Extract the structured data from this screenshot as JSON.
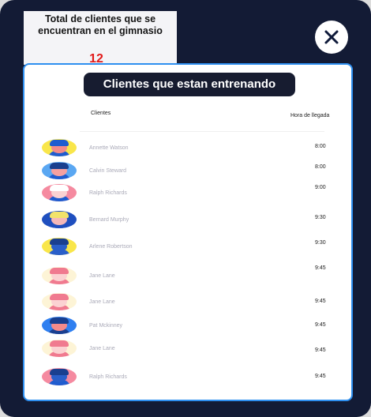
{
  "summary": {
    "title_line1": "Total de clientes que se",
    "title_line2": "encuentran en  el gimnasio",
    "count": "12"
  },
  "panel": {
    "title": "Clientes que estan entrenando",
    "col_clients": "Clientes",
    "col_arrival": "Hora de llegada"
  },
  "close_icon": "close-icon",
  "clients": [
    {
      "name": "Annette Watson",
      "time": "8:00",
      "bg": "#f9e64a",
      "skin": "#f28b8b",
      "hair": "#1f5ccf",
      "body": "#1f5ccf"
    },
    {
      "name": "Calvin Steward",
      "time": "8:00",
      "bg": "#5aa7f2",
      "skin": "#f5a0a0",
      "hair": "#1a3f8f",
      "body": "#1f5ccf"
    },
    {
      "name": "Ralph Richards",
      "time": "9:00",
      "bg": "#f58aa0",
      "skin": "#fbd2d2",
      "hair": "#ffffff",
      "body": "#1f5ccf"
    },
    {
      "name": "Bernard Murphy",
      "time": "9:30",
      "bg": "#1f4fbf",
      "skin": "#f5b8b8",
      "hair": "#f2e36a",
      "body": "#1f4fbf"
    },
    {
      "name": "Arlene Robertson",
      "time": "9:30",
      "bg": "#f9e64a",
      "skin": "#2a5fc9",
      "hair": "#1a3f8f",
      "body": "#2a5fc9"
    },
    {
      "name": "Jane Lane",
      "time": "9:45",
      "bg": "#fdf4d6",
      "skin": "#fbd2d2",
      "hair": "#f07a8f",
      "body": "#f07a8f"
    },
    {
      "name": "Jane Lane",
      "time": "9:45",
      "bg": "#fdf4d6",
      "skin": "#fbd2d2",
      "hair": "#f07a8f",
      "body": "#f07a8f"
    },
    {
      "name": "Pat Mckinney",
      "time": "9:45",
      "bg": "#2f7ff0",
      "skin": "#f58a8a",
      "hair": "#1a3f8f",
      "body": "#1a3f8f"
    },
    {
      "name": "Jane Lane",
      "time": "9:45",
      "bg": "#fdf4d6",
      "skin": "#fbd2d2",
      "hair": "#f07a8f",
      "body": "#f07a8f"
    },
    {
      "name": "Ralph Richards",
      "time": "9:45",
      "bg": "#f58aa0",
      "skin": "#2a5fc9",
      "hair": "#1a3f8f",
      "body": "#1f5ccf"
    }
  ]
}
